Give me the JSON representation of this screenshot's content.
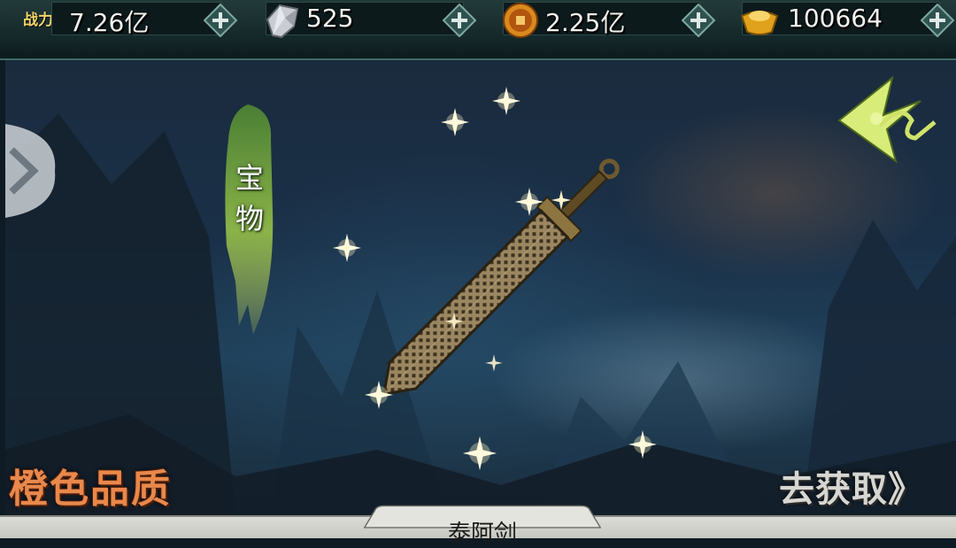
{
  "resources": {
    "power_label": "战力",
    "power_value": "7.26亿",
    "gems_value": "525",
    "coins_value": "2.25亿",
    "ingots_value": "100664"
  },
  "icons": {
    "plus": "plus-icon",
    "gem": "gem-icon",
    "coin": "coin-icon",
    "ingot": "ingot-icon"
  },
  "item": {
    "category": "宝物",
    "quality": "橙色品质",
    "name": "泰阿剑"
  },
  "actions": {
    "obtain_label": "去获取》"
  },
  "colors": {
    "quality_orange": "#e8884c",
    "banner_green": "#6a9a3a",
    "bar_teal": "#233a3a"
  }
}
